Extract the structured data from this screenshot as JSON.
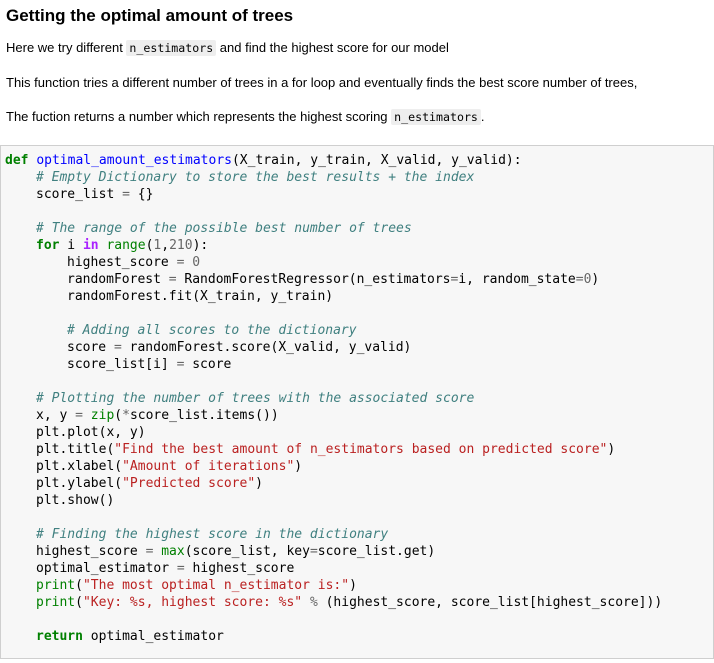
{
  "markdown": {
    "heading": "Getting the optimal amount of trees",
    "p1_before": "Here we try different ",
    "p1_code": "n_estimators",
    "p1_after": " and find the highest score for our model",
    "p2": "This function tries a different number of trees in a for loop and eventually finds the best score number of trees,",
    "p3_before": "The fuction returns a number which represents the highest scoring ",
    "p3_code": "n_estimators",
    "p3_after": "."
  },
  "code": {
    "l1_def": "def",
    "l1_name": "optimal_amount_estimators",
    "l1_args": "(X_train, y_train, X_valid, y_valid):",
    "l2": "# Empty Dictionary to store the best results + the index",
    "l3_a": "score_list ",
    "l3_op": "=",
    "l3_b": " {}",
    "l5": "# The range of the possible best number of trees",
    "l6_for": "for",
    "l6_i": " i ",
    "l6_in": "in",
    "l6_range": " range",
    "l6_p1": "(",
    "l6_n1": "1",
    "l6_c": ",",
    "l6_n2": "210",
    "l6_p2": "):",
    "l7_a": "highest_score ",
    "l7_op": "=",
    "l7_n": " 0",
    "l8_a": "randomForest ",
    "l8_op": "=",
    "l8_b": " RandomForestRegressor(n_estimators",
    "l8_op2": "=",
    "l8_c": "i, random_state",
    "l8_op3": "=",
    "l8_n": "0",
    "l8_d": ")",
    "l9": "randomForest.fit(X_train, y_train)",
    "l11": "# Adding all scores to the dictionary",
    "l12_a": "score ",
    "l12_op": "=",
    "l12_b": " randomForest.score(X_valid, y_valid)",
    "l13_a": "score_list[i] ",
    "l13_op": "=",
    "l13_b": " score",
    "l15": "# Plotting the number of trees with the associated score",
    "l16_a": "x, y ",
    "l16_op": "=",
    "l16_zip": " zip",
    "l16_p": "(",
    "l16_star": "*",
    "l16_b": "score_list.items())",
    "l17": "plt.plot(x, y)",
    "l18_a": "plt.title(",
    "l18_s": "\"Find the best amount of n_estimators based on predicted score\"",
    "l18_b": ")",
    "l19_a": "plt.xlabel(",
    "l19_s": "\"Amount of iterations\"",
    "l19_b": ")",
    "l20_a": "plt.ylabel(",
    "l20_s": "\"Predicted score\"",
    "l20_b": ")",
    "l21": "plt.show()",
    "l23": "# Finding the highest score in the dictionary",
    "l24_a": "highest_score ",
    "l24_op": "=",
    "l24_max": " max",
    "l24_b": "(score_list, key",
    "l24_op2": "=",
    "l24_c": "score_list.get)",
    "l25_a": "optimal_estimator ",
    "l25_op": "=",
    "l25_b": " highest_score",
    "l26_print": "print",
    "l26_a": "(",
    "l26_s": "\"The most optimal n_estimator is:\"",
    "l26_b": ")",
    "l27_print": "print",
    "l27_a": "(",
    "l27_s": "\"Key: %s, highest score: %s\"",
    "l27_sp": " ",
    "l27_op": "%",
    "l27_b": " (highest_score, score_list[highest_score]))",
    "l29_ret": "return",
    "l29_b": " optimal_estimator"
  }
}
